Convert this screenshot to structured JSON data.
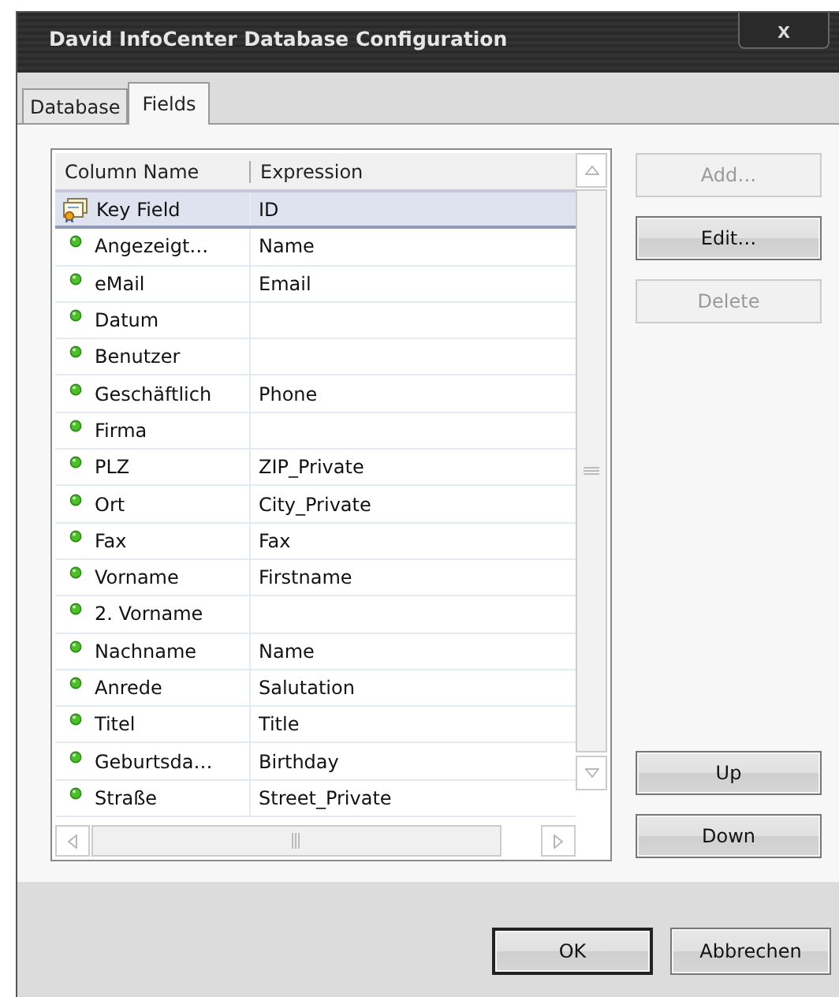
{
  "window": {
    "title": "David InfoCenter Database Configuration",
    "close": "x"
  },
  "tabs": [
    {
      "label": "Database",
      "selected": false
    },
    {
      "label": "Fields",
      "selected": true
    }
  ],
  "table": {
    "columns": [
      "Column Name",
      "Expression"
    ],
    "rows": [
      {
        "kind": "key",
        "name": "Key Field",
        "expression": "ID",
        "selected": true
      },
      {
        "kind": "field",
        "name": "Angezeigt…",
        "expression": "Name",
        "selected": false
      },
      {
        "kind": "field",
        "name": "eMail",
        "expression": "Email",
        "selected": false
      },
      {
        "kind": "field",
        "name": "Datum",
        "expression": "",
        "selected": false
      },
      {
        "kind": "field",
        "name": "Benutzer",
        "expression": "",
        "selected": false
      },
      {
        "kind": "field",
        "name": "Geschäftlich",
        "expression": "Phone",
        "selected": false
      },
      {
        "kind": "field",
        "name": "Firma",
        "expression": "",
        "selected": false
      },
      {
        "kind": "field",
        "name": "PLZ",
        "expression": "ZIP_Private",
        "selected": false
      },
      {
        "kind": "field",
        "name": "Ort",
        "expression": "City_Private",
        "selected": false
      },
      {
        "kind": "field",
        "name": "Fax",
        "expression": "Fax",
        "selected": false
      },
      {
        "kind": "field",
        "name": "Vorname",
        "expression": "Firstname",
        "selected": false
      },
      {
        "kind": "field",
        "name": "2. Vorname",
        "expression": "",
        "selected": false
      },
      {
        "kind": "field",
        "name": "Nachname",
        "expression": "Name",
        "selected": false
      },
      {
        "kind": "field",
        "name": "Anrede",
        "expression": "Salutation",
        "selected": false
      },
      {
        "kind": "field",
        "name": "Titel",
        "expression": "Title",
        "selected": false
      },
      {
        "kind": "field",
        "name": "Geburtsda…",
        "expression": "Birthday",
        "selected": false
      },
      {
        "kind": "field",
        "name": "Straße",
        "expression": "Street_Private",
        "selected": false
      }
    ]
  },
  "side_buttons": [
    {
      "label": "Add…",
      "disabled": true
    },
    {
      "label": "Edit…",
      "disabled": false
    },
    {
      "label": "Delete",
      "disabled": true
    }
  ],
  "move_buttons": [
    {
      "label": "Up",
      "disabled": false
    },
    {
      "label": "Down",
      "disabled": false
    }
  ],
  "footer_buttons": [
    {
      "label": "OK",
      "default": true
    },
    {
      "label": "Abbrechen",
      "default": false
    }
  ]
}
